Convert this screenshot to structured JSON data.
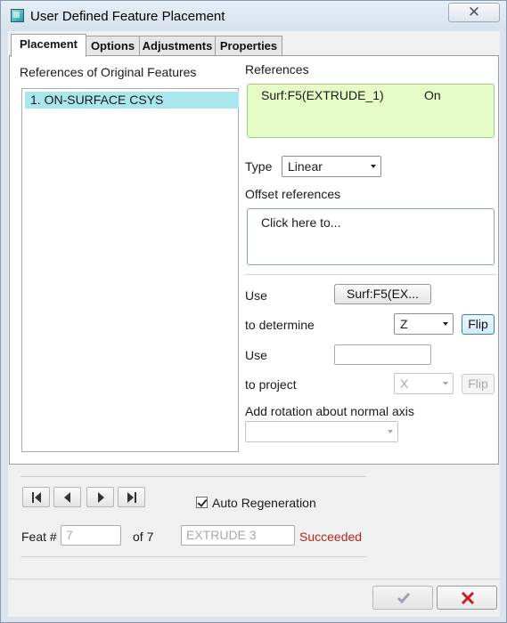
{
  "window": {
    "title": "User Defined Feature Placement",
    "close_label": "✕"
  },
  "tabs": [
    {
      "label": "Placement",
      "active": true
    },
    {
      "label": "Options",
      "active": false
    },
    {
      "label": "Adjustments",
      "active": false
    },
    {
      "label": "Properties",
      "active": false
    }
  ],
  "placement": {
    "original_refs_label": "References of Original Features",
    "original_refs": [
      "1. ON-SURFACE CSYS"
    ],
    "references_label": "References",
    "reference_name": "Surf:F5(EXTRUDE_1)",
    "reference_state": "On",
    "type_label": "Type",
    "type_value": "Linear",
    "offset_label": "Offset references",
    "offset_placeholder": "Click here to...",
    "use_label_1": "Use",
    "use_value_1": "Surf:F5(EX...",
    "determine_label": "to determine",
    "determine_value": "Z",
    "flip_label": "Flip",
    "use_label_2": "Use",
    "use_value_2": "",
    "project_label": "to project",
    "project_value": "X",
    "flip2_label": "Flip",
    "rotation_label": "Add rotation about normal axis",
    "rotation_value": ""
  },
  "footer": {
    "auto_regen_label": "Auto Regeneration",
    "auto_regen_checked": true,
    "feat_label": "Feat #",
    "feat_value": "7",
    "of_label": "of 7",
    "feat_name": "EXTRUDE 3",
    "status": "Succeeded",
    "status_color": "#b3261e"
  },
  "icons": {
    "app": "cube-icon",
    "first": "first-icon",
    "prev": "prev-icon",
    "next": "next-icon",
    "last": "last-icon",
    "ok": "checkmark-icon",
    "cancel": "cross-icon"
  }
}
